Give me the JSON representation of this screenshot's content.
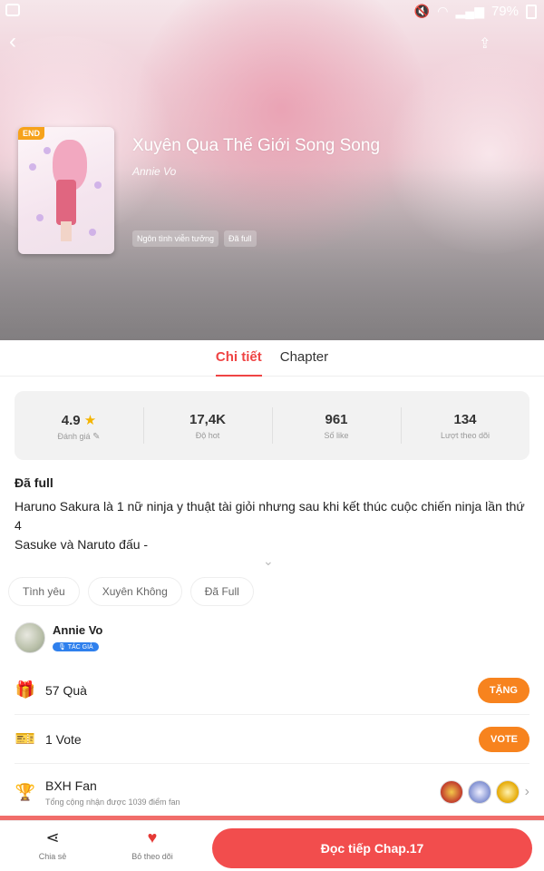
{
  "statusbar": {
    "battery": "79%"
  },
  "book": {
    "badge": "END",
    "title": "Xuyên Qua Thế Giới Song Song",
    "author": "Annie Vo",
    "tags": [
      "Ngôn tình viễn tưởng",
      "Đã full"
    ]
  },
  "tabs": [
    {
      "label": "Chi tiết",
      "active": true
    },
    {
      "label": "Chapter",
      "active": false
    }
  ],
  "stats": [
    {
      "value": "4.9",
      "label": "Đánh giá"
    },
    {
      "value": "17,4K",
      "label": "Độ hot"
    },
    {
      "value": "961",
      "label": "Số like"
    },
    {
      "value": "134",
      "label": "Lượt theo dõi"
    }
  ],
  "description": {
    "status": "Đã full",
    "line1": "Haruno Sakura là 1 nữ ninja y thuật tài giỏi nhưng sau khi kết thúc cuộc chiến ninja lần thứ 4",
    "line2": "Sasuke và Naruto đấu -"
  },
  "genres": [
    "Tình yêu",
    "Xuyên Không",
    "Đã Full"
  ],
  "author": {
    "name": "Annie Vo",
    "badge": "TÁC GIẢ"
  },
  "gift": {
    "label": "57 Quà",
    "button": "TẶNG"
  },
  "vote": {
    "label": "1 Vote",
    "button": "VOTE"
  },
  "fan": {
    "title": "BXH Fan",
    "subtitle": "Tổng cộng nhận được 1039 điểm fan"
  },
  "bottom": {
    "share_label": "Chia sẻ",
    "follow_label": "Bỏ theo dõi",
    "read_button": "Đọc tiếp Chap.17"
  },
  "colors": {
    "accent": "#ef4444",
    "orange": "#f7831e",
    "badge_blue": "#2f80ed"
  }
}
